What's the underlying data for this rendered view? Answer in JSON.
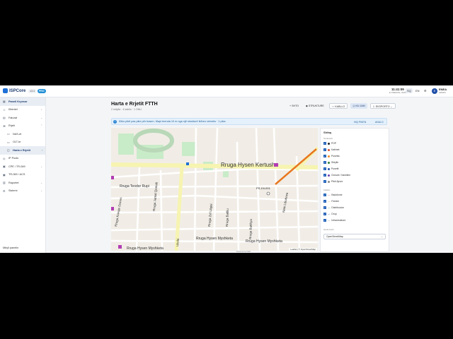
{
  "app": {
    "logo_text": "ISPCore",
    "version": "v3.4",
    "live_badge": "PRO",
    "clock": "11:41:09",
    "date": "E PREMTE, 2026",
    "lang_sq": "SQ",
    "lang_en": "EN",
    "avatar_initials": "E",
    "user_name": "ENEA",
    "user_role": "ADMIN"
  },
  "sidebar": {
    "items": [
      {
        "label": "Paneli Kryesor",
        "icon": "grid-icon"
      },
      {
        "label": "Klientet",
        "icon": "users-icon"
      },
      {
        "label": "Faturat",
        "icon": "invoice-icon"
      },
      {
        "label": "Rrjeti",
        "icon": "network-icon"
      },
      {
        "label": "NAS-et",
        "icon": "server-icon"
      },
      {
        "label": "OLT-te",
        "icon": "olt-icon"
      },
      {
        "label": "Harta e Rrjetit",
        "icon": "map-icon"
      },
      {
        "label": "IP Pools",
        "icon": "ip-icon"
      },
      {
        "label": "CPE / TR-069",
        "icon": "router-icon"
      },
      {
        "label": "TR-069 / ACS",
        "icon": "acs-icon"
      },
      {
        "label": "Raportet",
        "icon": "chart-icon"
      },
      {
        "label": "Sistemi",
        "icon": "gear-icon"
      }
    ],
    "bottom_label": "Mbyll panelin"
  },
  "page": {
    "title": "Harta e Rrjetit FTTH",
    "subtitle": "2 shtylla · 4 kabllo · 1 ONU"
  },
  "toolbar": {
    "b1": "SHTO",
    "b2": "STRUKTURE",
    "b3": "KABLLO",
    "b4": "KU JAM",
    "b5": "EKSPORTO"
  },
  "info": {
    "text": "Kliko pikë pas pike për trasen. Mapi brenda 10 m nga një strukturë lidhen vetvetiu · 1 pika",
    "action1": "HIQ PIKEN",
    "action2": "ANULO"
  },
  "map": {
    "street1": "Rruga Hysen Kertusha",
    "street2": "Rruga Teodor Rupi",
    "street3": "Rruga Hysen Myshketa",
    "street4": "Rruga Hysen Myshketa",
    "street5": "Rruga Kavaje Durres",
    "street6": "Rruga Jamal Qemali",
    "street7": "Rruga Zef Ulqini",
    "street8": "Rruga Batlliu",
    "street9": "Rruga Batthya",
    "street10": "Rruga Qefil Jakova",
    "street11": "Ukchi",
    "street12": "Neki Libohova",
    "marker_label": "PS-1N-001",
    "attribution": "Leaflet | © OpenStreetMap",
    "powered": "Powered by ISPA"
  },
  "panel": {
    "title": "Shfaq",
    "sec_structures": "Strukturat",
    "structures": [
      {
        "label": "POP",
        "color": "#222"
      },
      {
        "label": "Kabinet",
        "color": "#d54c2c"
      },
      {
        "label": "Pusetta",
        "color": "#f08c2a"
      },
      {
        "label": "Shtylle",
        "color": "#2f7d32"
      },
      {
        "label": "Pusetë",
        "color": "#1f4fa8"
      },
      {
        "label": "Closure / bashkim",
        "color": "#6a3fb0"
      },
      {
        "label": "Pikë Ajrore",
        "color": "#888"
      }
    ],
    "sec_cables": "Kabllot",
    "cables": [
      {
        "label": "Backbone",
        "color": "#d54c2c"
      },
      {
        "label": "Feeder",
        "color": "#f08c2a"
      },
      {
        "label": "Distribucion",
        "color": "#2f7d32"
      },
      {
        "label": "Drop",
        "color": "#1f4fa8"
      },
      {
        "label": "Infrastrukture",
        "color": "#888"
      }
    ],
    "sec_basemap": "Harta bazë",
    "basemap_value": "OpenStreetMap"
  },
  "colors": {
    "accent": "#1f5fb8",
    "cable_trace": "#e8771f",
    "park": "#c8ebc8",
    "major_road": "#f6f4b0"
  }
}
